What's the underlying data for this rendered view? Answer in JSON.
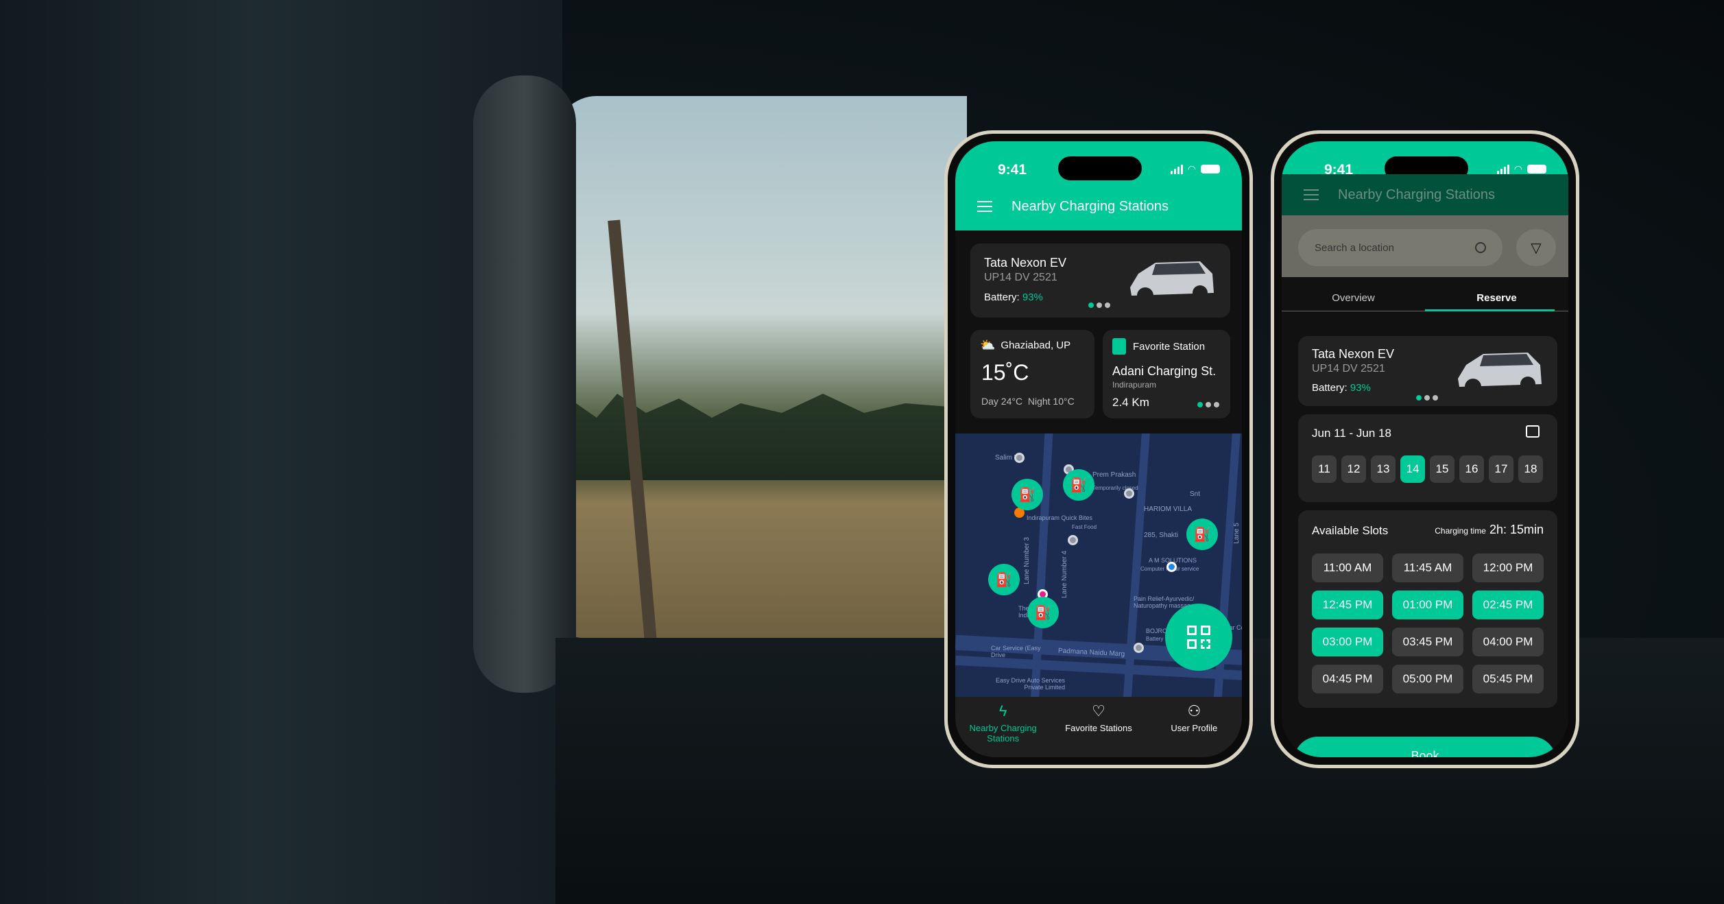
{
  "colors": {
    "accent": "#00c897",
    "card": "#222222",
    "map": "#1c2b50"
  },
  "status": {
    "time": "9:41"
  },
  "phone1": {
    "title": "Nearby Charging Stations",
    "vehicle": {
      "name": "Tata Nexon EV",
      "plate": "UP14 DV 2521",
      "battery_label": "Battery:",
      "battery_value": "93%"
    },
    "weather": {
      "location": "Ghaziabad, UP",
      "temp": "15˚C",
      "day": "Day 24°C",
      "night": "Night 10°C",
      "icon": "partly-sunny-icon"
    },
    "favorite": {
      "label": "Favorite Station",
      "name": "Adani Charging St.",
      "area": "Indirapuram",
      "distance": "2.4 Km"
    },
    "map_labels": [
      "Salim 's",
      "Prem Prakash",
      "Temporarily closed",
      "Snt",
      "HARIOM VILLA",
      "Indirapuram Quick Bites",
      "Fast Food",
      "285, Shakti",
      "A M SOLUTIONS",
      "Computer repair service",
      "Pain Relief-Ayurvedic/ Naturopathy massage...",
      "The Grand Indirapuram",
      "BOJRO",
      "Battery",
      "Malabar Co",
      "Car Service (Easy Drive",
      "Padmana Naidu Marg",
      "Easy Drive Auto Services Private Limited",
      "Lane Number 3",
      "Lane Number 4",
      "Lane 5"
    ],
    "nav": [
      {
        "label": "Nearby Charging Stations",
        "icon": "charging-icon"
      },
      {
        "label": "Favorite Stations",
        "icon": "heart-icon"
      },
      {
        "label": "User Profile",
        "icon": "user-icon"
      }
    ]
  },
  "phone2": {
    "title": "Nearby Charging Stations",
    "search_placeholder": "Search a location",
    "tabs": [
      "Overview",
      "Reserve"
    ],
    "active_tab": "Reserve",
    "vehicle": {
      "name": "Tata Nexon EV",
      "plate": "UP14 DV 2521",
      "battery_label": "Battery:",
      "battery_value": "93%"
    },
    "date_range": "Jun 11 - Jun 18",
    "dates": [
      "11",
      "12",
      "13",
      "14",
      "15",
      "16",
      "17",
      "18"
    ],
    "selected_date": "14",
    "slots_title": "Available Slots",
    "charging_time_label": "Charging time",
    "charging_time": "2h: 15min",
    "slots": [
      {
        "time": "11:00 AM",
        "selected": false
      },
      {
        "time": "11:45 AM",
        "selected": false
      },
      {
        "time": "12:00 PM",
        "selected": false
      },
      {
        "time": "12:45 PM",
        "selected": true
      },
      {
        "time": "01:00 PM",
        "selected": true
      },
      {
        "time": "02:45 PM",
        "selected": true
      },
      {
        "time": "03:00 PM",
        "selected": true
      },
      {
        "time": "03:45 PM",
        "selected": false
      },
      {
        "time": "04:00 PM",
        "selected": false
      },
      {
        "time": "04:45 PM",
        "selected": false
      },
      {
        "time": "05:00 PM",
        "selected": false
      },
      {
        "time": "05:45 PM",
        "selected": false
      }
    ],
    "book_label": "Book"
  }
}
